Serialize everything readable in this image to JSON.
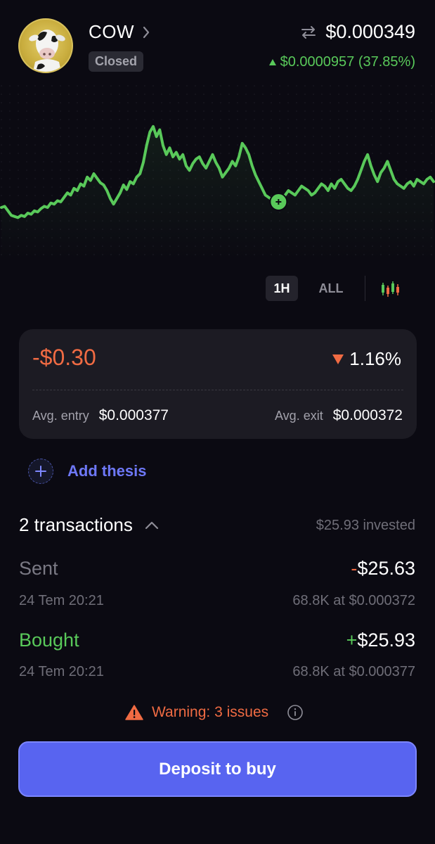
{
  "coin": {
    "name": "COW",
    "status": "Closed",
    "price": "$0.000349",
    "change": "$0.0000957 (37.85%)"
  },
  "chart": {
    "series": [
      0.25,
      0.26,
      0.22,
      0.18,
      0.17,
      0.16,
      0.18,
      0.17,
      0.2,
      0.19,
      0.22,
      0.21,
      0.24,
      0.26,
      0.25,
      0.29,
      0.28,
      0.31,
      0.3,
      0.34,
      0.38,
      0.36,
      0.42,
      0.4,
      0.46,
      0.44,
      0.52,
      0.49,
      0.55,
      0.51,
      0.47,
      0.45,
      0.4,
      0.33,
      0.28,
      0.33,
      0.38,
      0.45,
      0.41,
      0.48,
      0.46,
      0.52,
      0.55,
      0.65,
      0.8,
      0.92,
      0.97,
      0.88,
      0.94,
      0.8,
      0.72,
      0.78,
      0.7,
      0.74,
      0.68,
      0.72,
      0.62,
      0.58,
      0.64,
      0.68,
      0.7,
      0.64,
      0.6,
      0.66,
      0.72,
      0.65,
      0.6,
      0.52,
      0.56,
      0.6,
      0.66,
      0.62,
      0.7,
      0.82,
      0.78,
      0.72,
      0.62,
      0.54,
      0.48,
      0.42,
      0.36,
      0.34,
      0.32,
      0.28,
      0.3,
      0.32,
      0.36,
      0.4,
      0.38,
      0.36,
      0.4,
      0.44,
      0.42,
      0.4,
      0.36,
      0.38,
      0.42,
      0.46,
      0.44,
      0.4,
      0.46,
      0.42,
      0.48,
      0.5,
      0.46,
      0.42,
      0.4,
      0.44,
      0.5,
      0.58,
      0.66,
      0.72,
      0.62,
      0.54,
      0.48,
      0.56,
      0.6,
      0.66,
      0.58,
      0.5,
      0.46,
      0.44,
      0.42,
      0.46,
      0.48,
      0.44,
      0.5,
      0.48,
      0.46,
      0.5,
      0.52,
      0.48
    ],
    "marker_index": 84
  },
  "range": {
    "active": "1H",
    "inactive": "ALL"
  },
  "position": {
    "pnl": "-$0.30",
    "pnl_pct": "1.16%",
    "avg_entry_label": "Avg. entry",
    "avg_entry": "$0.000377",
    "avg_exit_label": "Avg. exit",
    "avg_exit": "$0.000372"
  },
  "thesis": {
    "label": "Add thesis"
  },
  "transactions": {
    "title": "2 transactions",
    "invested": "$25.93 invested",
    "items": [
      {
        "type": "Sent",
        "sign": "-",
        "amount": "$25.63",
        "date": "24 Tem 20:21",
        "detail": "68.8K at $0.000372"
      },
      {
        "type": "Bought",
        "sign": "+",
        "amount": "$25.93",
        "date": "24 Tem 20:21",
        "detail": "68.8K at $0.000377"
      }
    ]
  },
  "warning": {
    "text": "Warning: 3 issues"
  },
  "deposit": {
    "label": "Deposit to buy"
  },
  "colors": {
    "background": "#0b0a12",
    "positive": "#59c95a",
    "negative": "#f06b43",
    "accent": "#5864f0",
    "card": "#1c1b23"
  },
  "icons": {
    "avatar": "cow-avatar",
    "chevron": "chevron-right-icon",
    "swap": "swap-icon",
    "candles": "candlestick-icon",
    "plus": "plus-icon",
    "collapse": "chevron-up-icon",
    "warning": "warning-triangle-icon",
    "info": "info-icon"
  }
}
